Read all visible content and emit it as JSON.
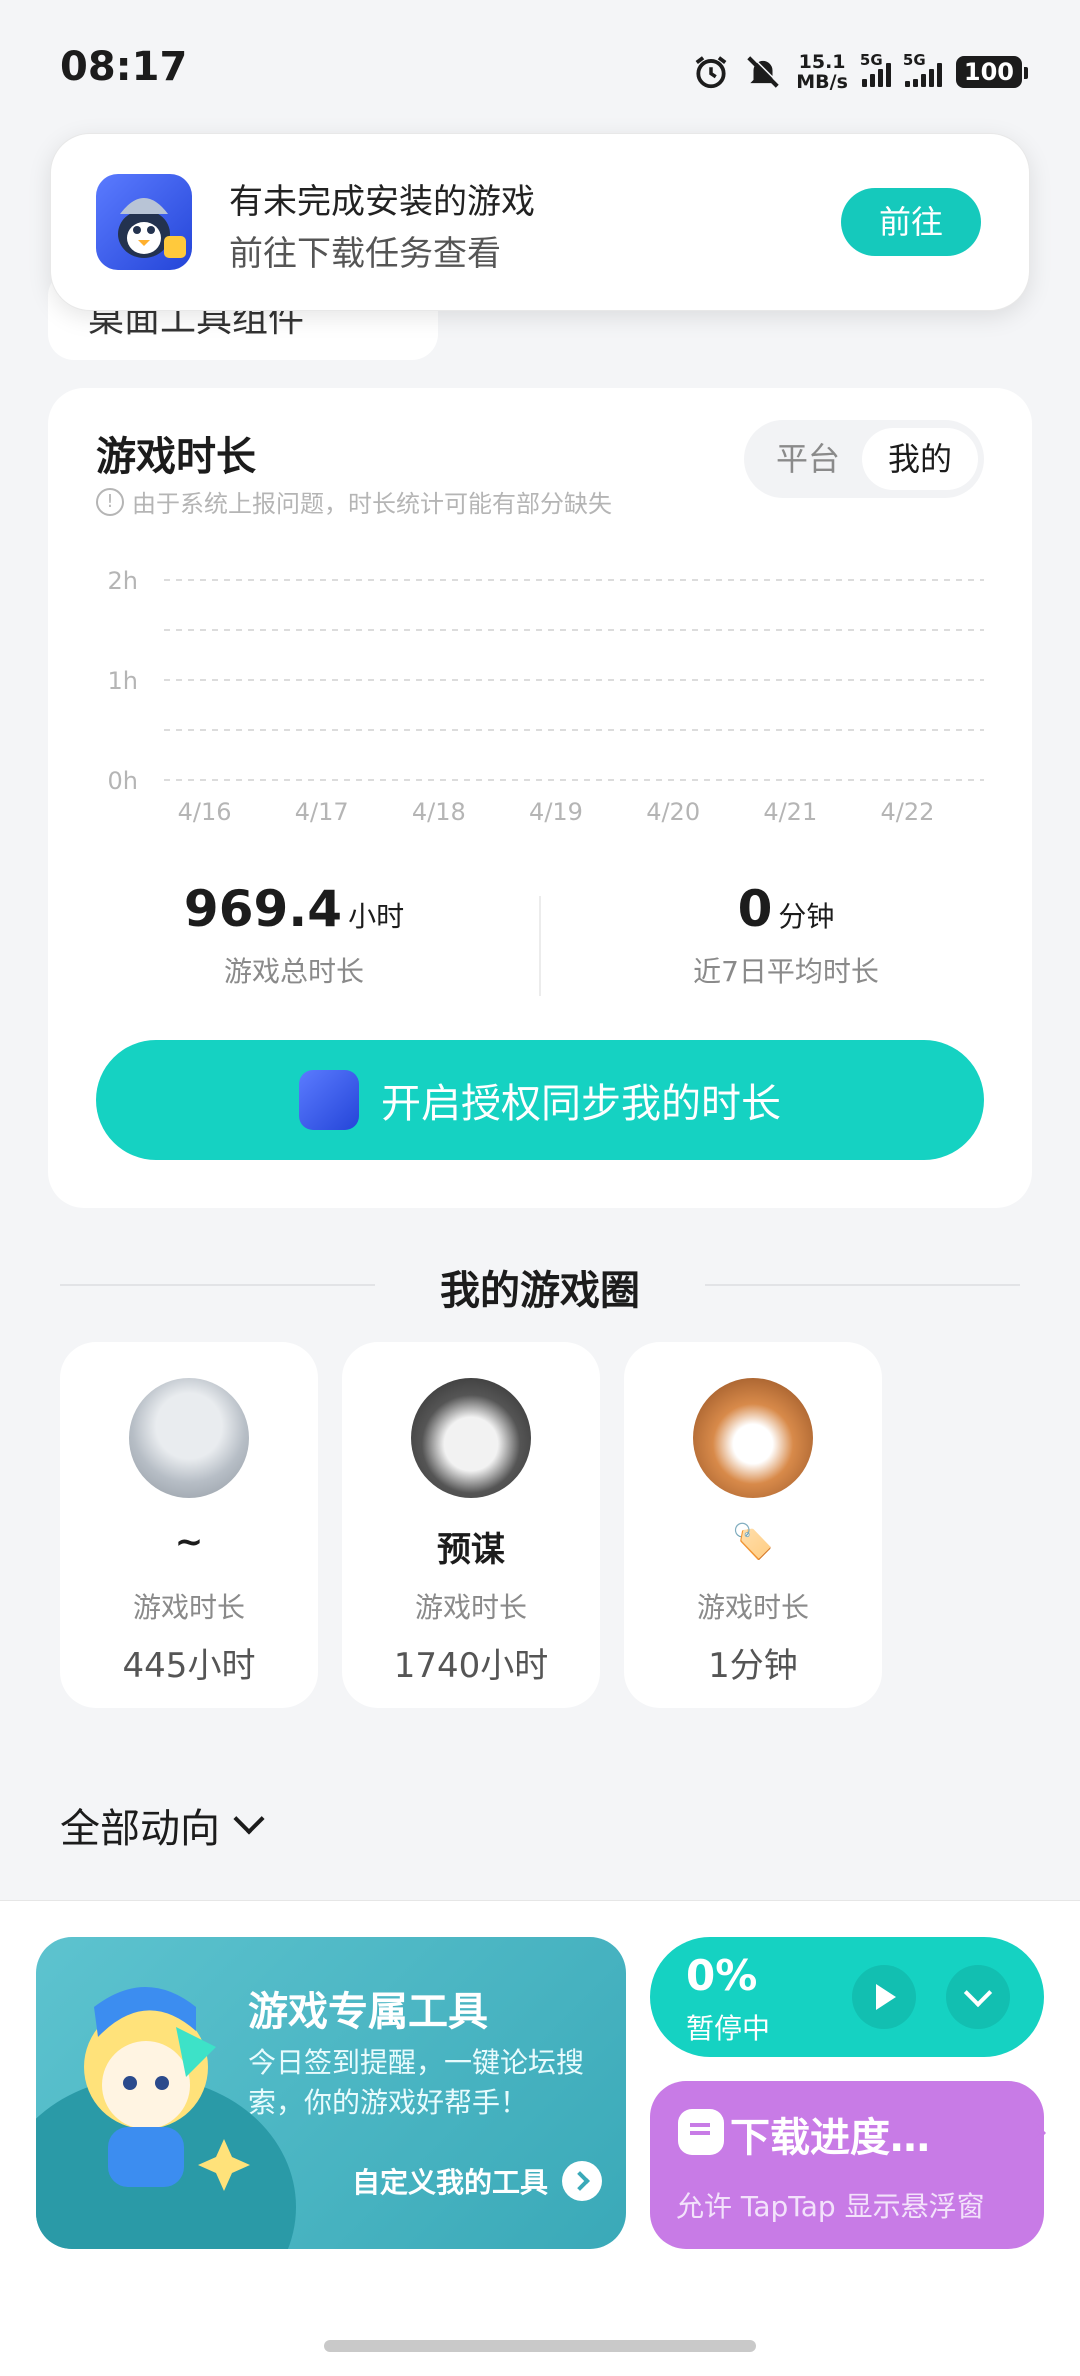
{
  "status_bar": {
    "time": "08:17",
    "net_speed_top": "15.1",
    "net_speed_bottom": "MB/s",
    "sim1": "5G",
    "sim2": "5G",
    "battery": "100"
  },
  "desk_widget": {
    "label": "桌面工具组件"
  },
  "notification": {
    "title": "有未完成安装的游戏",
    "subtitle": "前往下载任务查看",
    "button": "前往"
  },
  "playtime": {
    "title": "游戏时长",
    "note": "由于系统上报问题，时长统计可能有部分缺失",
    "toggle_platform": "平台",
    "toggle_mine": "我的",
    "total_value": "969.4",
    "total_unit": "小时",
    "total_label": "游戏总时长",
    "avg_value": "0",
    "avg_unit": "分钟",
    "avg_label": "近7日平均时长",
    "auth_button": "开启授权同步我的时长"
  },
  "chart_data": {
    "type": "bar",
    "categories": [
      "4/16",
      "4/17",
      "4/18",
      "4/19",
      "4/20",
      "4/21",
      "4/22"
    ],
    "values": [
      0,
      0,
      0,
      0,
      0,
      0,
      0
    ],
    "y_ticks": [
      "0h",
      "1h",
      "2h"
    ],
    "ylim": [
      0,
      2
    ],
    "grid": true
  },
  "game_circle": {
    "title": "我的游戏圈",
    "friends": [
      {
        "name": "~",
        "label": "游戏时长",
        "value": "445小时"
      },
      {
        "name": "预谋",
        "label": "游戏时长",
        "value": "1740小时"
      },
      {
        "name": "🏷️",
        "label": "游戏时长",
        "value": "1分钟"
      }
    ]
  },
  "activity": {
    "label": "全部动向"
  },
  "tool_card": {
    "title": "游戏专属工具",
    "desc": "今日签到提醒，一键论坛搜索，你的游戏好帮手！",
    "link": "自定义我的工具"
  },
  "download": {
    "percent": "0%",
    "state": "暂停中",
    "card_title": "下载进度…",
    "card_desc": "允许 TapTap 显示悬浮窗"
  },
  "colors": {
    "accent": "#15d2c2",
    "tool_card": "#4cb8c6",
    "download_card": "#c87be6"
  }
}
